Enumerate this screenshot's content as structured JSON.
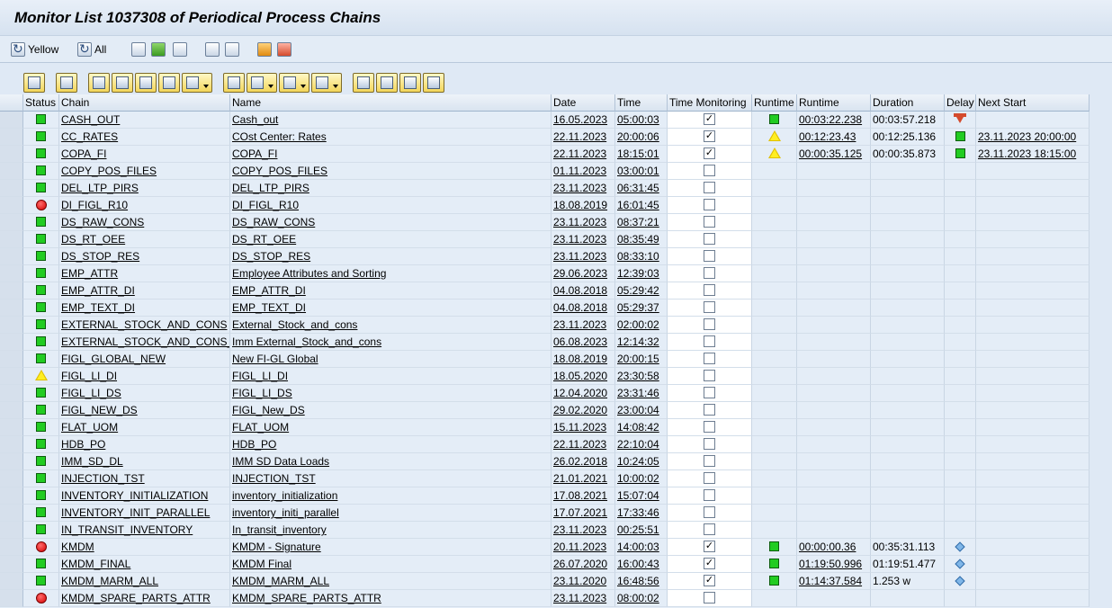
{
  "title": "Monitor List 1037308 of Periodical Process Chains",
  "app_toolbar": {
    "yellow_label": "Yellow",
    "all_label": "All"
  },
  "columns": {
    "status": "Status",
    "chain": "Chain",
    "name": "Name",
    "date": "Date",
    "time": "Time",
    "time_monitoring": "Time Monitoring",
    "runtime_status": "Runtime",
    "runtime": "Runtime",
    "duration": "Duration",
    "delay": "Delay",
    "next_start": "Next Start"
  },
  "status_colors": {
    "green": "#22cc22",
    "red": "#d60000",
    "yellow": "#ffee22"
  },
  "rows": [
    {
      "status": "green",
      "chain": "CASH_OUT",
      "name": "Cash_out",
      "date": "16.05.2023",
      "time": "05:00:03",
      "monitored": true,
      "rt_status": "green",
      "runtime": "00:03:22.238",
      "duration": "00:03:57.218",
      "delay": "hourglass",
      "next_start": ""
    },
    {
      "status": "green",
      "chain": "CC_RATES",
      "name": "COst Center: Rates",
      "date": "22.11.2023",
      "time": "20:00:06",
      "monitored": true,
      "rt_status": "yellow",
      "runtime": "00:12:23.43",
      "duration": "00:12:25.136",
      "delay": "green",
      "next_start": "23.11.2023 20:00:00"
    },
    {
      "status": "green",
      "chain": "COPA_FI",
      "name": "COPA_FI",
      "date": "22.11.2023",
      "time": "18:15:01",
      "monitored": true,
      "rt_status": "yellow",
      "runtime": "00:00:35.125",
      "duration": "00:00:35.873",
      "delay": "green",
      "next_start": "23.11.2023 18:15:00"
    },
    {
      "status": "green",
      "chain": "COPY_POS_FILES",
      "name": "COPY_POS_FILES",
      "date": "01.11.2023",
      "time": "03:00:01",
      "monitored": false,
      "rt_status": "",
      "runtime": "",
      "duration": "",
      "delay": "",
      "next_start": ""
    },
    {
      "status": "green",
      "chain": "DEL_LTP_PIRS",
      "name": "DEL_LTP_PIRS",
      "date": "23.11.2023",
      "time": "06:31:45",
      "monitored": false,
      "rt_status": "",
      "runtime": "",
      "duration": "",
      "delay": "",
      "next_start": ""
    },
    {
      "status": "red",
      "chain": "DI_FIGL_R10",
      "name": "DI_FIGL_R10",
      "date": "18.08.2019",
      "time": "16:01:45",
      "monitored": false,
      "rt_status": "",
      "runtime": "",
      "duration": "",
      "delay": "",
      "next_start": ""
    },
    {
      "status": "green",
      "chain": "DS_RAW_CONS",
      "name": "DS_RAW_CONS",
      "date": "23.11.2023",
      "time": "08:37:21",
      "monitored": false,
      "rt_status": "",
      "runtime": "",
      "duration": "",
      "delay": "",
      "next_start": ""
    },
    {
      "status": "green",
      "chain": "DS_RT_OEE",
      "name": "DS_RT_OEE",
      "date": "23.11.2023",
      "time": "08:35:49",
      "monitored": false,
      "rt_status": "",
      "runtime": "",
      "duration": "",
      "delay": "",
      "next_start": ""
    },
    {
      "status": "green",
      "chain": "DS_STOP_RES",
      "name": "DS_STOP_RES",
      "date": "23.11.2023",
      "time": "08:33:10",
      "monitored": false,
      "rt_status": "",
      "runtime": "",
      "duration": "",
      "delay": "",
      "next_start": ""
    },
    {
      "status": "green",
      "chain": "EMP_ATTR",
      "name": "Employee Attributes and Sorting",
      "date": "29.06.2023",
      "time": "12:39:03",
      "monitored": false,
      "rt_status": "",
      "runtime": "",
      "duration": "",
      "delay": "",
      "next_start": ""
    },
    {
      "status": "green",
      "chain": "EMP_ATTR_DI",
      "name": "EMP_ATTR_DI",
      "date": "04.08.2018",
      "time": "05:29:42",
      "monitored": false,
      "rt_status": "",
      "runtime": "",
      "duration": "",
      "delay": "",
      "next_start": ""
    },
    {
      "status": "green",
      "chain": "EMP_TEXT_DI",
      "name": "EMP_TEXT_DI",
      "date": "04.08.2018",
      "time": "05:29:37",
      "monitored": false,
      "rt_status": "",
      "runtime": "",
      "duration": "",
      "delay": "",
      "next_start": ""
    },
    {
      "status": "green",
      "chain": "EXTERNAL_STOCK_AND_CONS",
      "name": "External_Stock_and_cons",
      "date": "23.11.2023",
      "time": "02:00:02",
      "monitored": false,
      "rt_status": "",
      "runtime": "",
      "duration": "",
      "delay": "",
      "next_start": ""
    },
    {
      "status": "green",
      "chain": "EXTERNAL_STOCK_AND_CONS_I",
      "name": "Imm External_Stock_and_cons",
      "date": "06.08.2023",
      "time": "12:14:32",
      "monitored": false,
      "rt_status": "",
      "runtime": "",
      "duration": "",
      "delay": "",
      "next_start": ""
    },
    {
      "status": "green",
      "chain": "FIGL_GLOBAL_NEW",
      "name": "New FI-GL Global",
      "date": "18.08.2019",
      "time": "20:00:15",
      "monitored": false,
      "rt_status": "",
      "runtime": "",
      "duration": "",
      "delay": "",
      "next_start": ""
    },
    {
      "status": "yellow",
      "chain": "FIGL_LI_DI",
      "name": "FIGL_LI_DI",
      "date": "18.05.2020",
      "time": "23:30:58",
      "monitored": false,
      "rt_status": "",
      "runtime": "",
      "duration": "",
      "delay": "",
      "next_start": ""
    },
    {
      "status": "green",
      "chain": "FIGL_LI_DS",
      "name": "FIGL_LI_DS",
      "date": "12.04.2020",
      "time": "23:31:46",
      "monitored": false,
      "rt_status": "",
      "runtime": "",
      "duration": "",
      "delay": "",
      "next_start": ""
    },
    {
      "status": "green",
      "chain": "FIGL_NEW_DS",
      "name": "FIGL_New_DS",
      "date": "29.02.2020",
      "time": "23:00:04",
      "monitored": false,
      "rt_status": "",
      "runtime": "",
      "duration": "",
      "delay": "",
      "next_start": ""
    },
    {
      "status": "green",
      "chain": "FLAT_UOM",
      "name": "FLAT_UOM",
      "date": "15.11.2023",
      "time": "14:08:42",
      "monitored": false,
      "rt_status": "",
      "runtime": "",
      "duration": "",
      "delay": "",
      "next_start": ""
    },
    {
      "status": "green",
      "chain": "HDB_PO",
      "name": "HDB_PO",
      "date": "22.11.2023",
      "time": "22:10:04",
      "monitored": false,
      "rt_status": "",
      "runtime": "",
      "duration": "",
      "delay": "",
      "next_start": ""
    },
    {
      "status": "green",
      "chain": "IMM_SD_DL",
      "name": "IMM SD Data Loads",
      "date": "26.02.2018",
      "time": "10:24:05",
      "monitored": false,
      "rt_status": "",
      "runtime": "",
      "duration": "",
      "delay": "",
      "next_start": ""
    },
    {
      "status": "green",
      "chain": "INJECTION_TST",
      "name": "INJECTION_TST",
      "date": "21.01.2021",
      "time": "10:00:02",
      "monitored": false,
      "rt_status": "",
      "runtime": "",
      "duration": "",
      "delay": "",
      "next_start": ""
    },
    {
      "status": "green",
      "chain": "INVENTORY_INITIALIZATION",
      "name": "inventory_initialization",
      "date": "17.08.2021",
      "time": "15:07:04",
      "monitored": false,
      "rt_status": "",
      "runtime": "",
      "duration": "",
      "delay": "",
      "next_start": ""
    },
    {
      "status": "green",
      "chain": "INVENTORY_INIT_PARALLEL",
      "name": "inventory_initi_parallel",
      "date": "17.07.2021",
      "time": "17:33:46",
      "monitored": false,
      "rt_status": "",
      "runtime": "",
      "duration": "",
      "delay": "",
      "next_start": ""
    },
    {
      "status": "green",
      "chain": "IN_TRANSIT_INVENTORY",
      "name": "In_transit_inventory",
      "date": "23.11.2023",
      "time": "00:25:51",
      "monitored": false,
      "rt_status": "",
      "runtime": "",
      "duration": "",
      "delay": "",
      "next_start": ""
    },
    {
      "status": "red",
      "chain": "KMDM",
      "name": "KMDM - Signature",
      "date": "20.11.2023",
      "time": "14:00:03",
      "monitored": true,
      "rt_status": "green",
      "runtime": "00:00:00.36",
      "duration": "00:35:31.113",
      "delay": "diamond",
      "next_start": ""
    },
    {
      "status": "green",
      "chain": "KMDM_FINAL",
      "name": "KMDM Final",
      "date": "26.07.2020",
      "time": "16:00:43",
      "monitored": true,
      "rt_status": "green",
      "runtime": "01:19:50.996",
      "duration": "01:19:51.477",
      "delay": "diamond",
      "next_start": ""
    },
    {
      "status": "green",
      "chain": "KMDM_MARM_ALL",
      "name": "KMDM_MARM_ALL",
      "date": "23.11.2020",
      "time": "16:48:56",
      "monitored": true,
      "rt_status": "green",
      "runtime": "01:14:37.584",
      "duration": "1.253 w",
      "delay": "diamond",
      "next_start": ""
    },
    {
      "status": "red",
      "chain": "KMDM_SPARE_PARTS_ATTR",
      "name": "KMDM_SPARE_PARTS_ATTR",
      "date": "23.11.2023",
      "time": "08:00:02",
      "monitored": false,
      "rt_status": "",
      "runtime": "",
      "duration": "",
      "delay": "",
      "next_start": ""
    }
  ]
}
